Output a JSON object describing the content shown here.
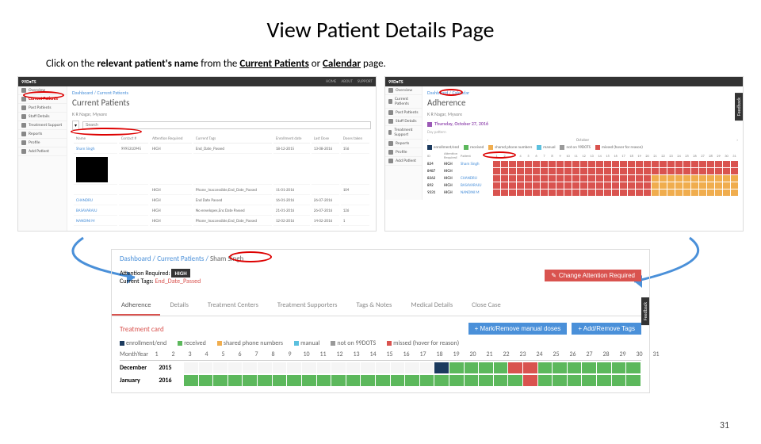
{
  "slide": {
    "title": "View Patient Details Page",
    "subtitle_prefix": "Click on the ",
    "subtitle_bold": "relevant patient's name",
    "subtitle_mid": " from the ",
    "subtitle_link1": "Current Patients",
    "subtitle_or": " or ",
    "subtitle_link2": "Calendar",
    "subtitle_suffix": " page.",
    "page_number": "31"
  },
  "left_shot": {
    "logo": "99D•TS",
    "topnav": [
      "HOME",
      "ABOUT",
      "SUPPORT"
    ],
    "sidebar": [
      "Overview",
      "Current Patients",
      "Past Patients",
      "Staff Details",
      "Treatment Support",
      "Reports",
      "Profile",
      "Add Patient"
    ],
    "breadcrumb": "Dashboard / Current Patients",
    "page_title": "Current Patients",
    "subhead": "K R Nagar, Mysore",
    "search_placeholder": "Search",
    "table_headers": [
      "Name",
      "Contact #",
      "Attention Required",
      "Current Tags",
      "Enrollment date",
      "Last Dose",
      "Doses taken"
    ],
    "rows": [
      {
        "name": "Sham Singh",
        "contact": "9995310945",
        "attn": "HIGH",
        "tags": "End_Date_Passed",
        "enroll": "18-12-2015",
        "last": "13-08-2016",
        "doses": "156"
      },
      {
        "name": "",
        "contact": "",
        "attn": "",
        "tags": "",
        "enroll": "",
        "last": "",
        "doses": ""
      },
      {
        "name": "",
        "contact": "",
        "attn": "HIGH",
        "tags": "Phone_Inaccessible,End_Date_Passed",
        "enroll": "11-01-2016",
        "last": "",
        "doses": "104"
      },
      {
        "name": "CHANDRU",
        "contact": "",
        "attn": "HIGH",
        "tags": "End Date Passed",
        "enroll": "16-01-2016",
        "last": "26-07-2016",
        "doses": ""
      },
      {
        "name": "BASAVARAJU",
        "contact": "",
        "attn": "HIGH",
        "tags": "No envelopes,Enc Date Passed",
        "enroll": "21-01-2016",
        "last": "26-07-2016",
        "doses": "126"
      },
      {
        "name": "NANDINI M",
        "contact": "",
        "attn": "HIGH",
        "tags": "Phone_Inaccessible,End_Date_Passed",
        "enroll": "12-02-2016",
        "last": "14-02-2016",
        "doses": "1"
      }
    ]
  },
  "right_shot": {
    "logo": "99D•TS",
    "sidebar": [
      "Overview",
      "Current Patients",
      "Past Patients",
      "Staff Details",
      "Treatment Support",
      "Reports",
      "Profile",
      "Add Patient"
    ],
    "breadcrumb": "Dashboard / Calendar",
    "page_title": "Adherence",
    "subhead": "K R Nagar, Mysore",
    "date_label": "Thursday, October 27, 2016",
    "pills_label": "Day pattern",
    "month_nav": {
      "prev": "‹",
      "label": "October",
      "next": "›"
    },
    "legend": [
      "enrollment/end",
      "received",
      "shared phone numbers",
      "manual",
      "not on 99DOTS",
      "missed (hover for reason)"
    ],
    "day_header": [
      "ID",
      "Attention Required",
      "Patient",
      "1",
      "2",
      "3",
      "4",
      "5",
      "6",
      "7",
      "8",
      "9",
      "10",
      "11",
      "12",
      "13",
      "14",
      "15",
      "16",
      "17",
      "18",
      "19",
      "20",
      "21",
      "22",
      "23",
      "24",
      "25",
      "26",
      "27",
      "28",
      "29",
      "30",
      "31"
    ],
    "rows": [
      {
        "id": "834",
        "attn": "HIGH",
        "name": "Sham Singh"
      },
      {
        "id": "8487",
        "attn": "HIGH",
        "name": ""
      },
      {
        "id": "8362",
        "attn": "HIGH",
        "name": "CHANDRU"
      },
      {
        "id": "892",
        "attn": "HIGH",
        "name": "BASAVARAJU"
      },
      {
        "id": "9331",
        "attn": "HIGH",
        "name": "NANDINI M"
      }
    ]
  },
  "detail_shot": {
    "breadcrumb_parts": [
      "Dashboard",
      "Current Patients",
      "Sham Singh"
    ],
    "attn_label": "Attention Required:",
    "attn_value": "HIGH",
    "tags_label": "Current Tags:",
    "tags_value": "End_Date_Passed",
    "change_attn_btn": "Change Attention Required",
    "tabs": [
      "Adherence",
      "Details",
      "Treatment Centers",
      "Treatment Supporters",
      "Tags & Notes",
      "Medical Details",
      "Close Case"
    ],
    "tcard_title": "Treatment card",
    "btn_mark": "Mark/Remove manual doses",
    "btn_tags": "Add/Remove Tags",
    "legend": [
      "enrollment/end",
      "received",
      "shared phone numbers",
      "manual",
      "not on 99DOTS",
      "missed (hover for reason)"
    ],
    "grid_header_month": "Month",
    "grid_header_year": "Year",
    "days": [
      "1",
      "2",
      "3",
      "4",
      "5",
      "6",
      "7",
      "8",
      "9",
      "10",
      "11",
      "12",
      "13",
      "14",
      "15",
      "16",
      "17",
      "18",
      "19",
      "20",
      "21",
      "22",
      "23",
      "24",
      "25",
      "26",
      "27",
      "28",
      "29",
      "30",
      "31"
    ],
    "rows": [
      {
        "month": "December",
        "year": "2015",
        "cells": [
          "e",
          "e",
          "e",
          "e",
          "e",
          "e",
          "e",
          "e",
          "e",
          "e",
          "e",
          "e",
          "e",
          "e",
          "e",
          "e",
          "e",
          "b",
          "g",
          "g",
          "g",
          "g",
          "r",
          "r",
          "g",
          "g",
          "g",
          "g",
          "g",
          "g",
          "g"
        ]
      },
      {
        "month": "January",
        "year": "2016",
        "cells": [
          "g",
          "g",
          "g",
          "g",
          "g",
          "g",
          "g",
          "g",
          "g",
          "g",
          "g",
          "g",
          "g",
          "g",
          "g",
          "g",
          "g",
          "g",
          "g",
          "g",
          "g",
          "g",
          "g",
          "r",
          "g",
          "g",
          "g",
          "g",
          "g",
          "g",
          "g"
        ]
      }
    ],
    "feedback_label": "Feedback"
  }
}
